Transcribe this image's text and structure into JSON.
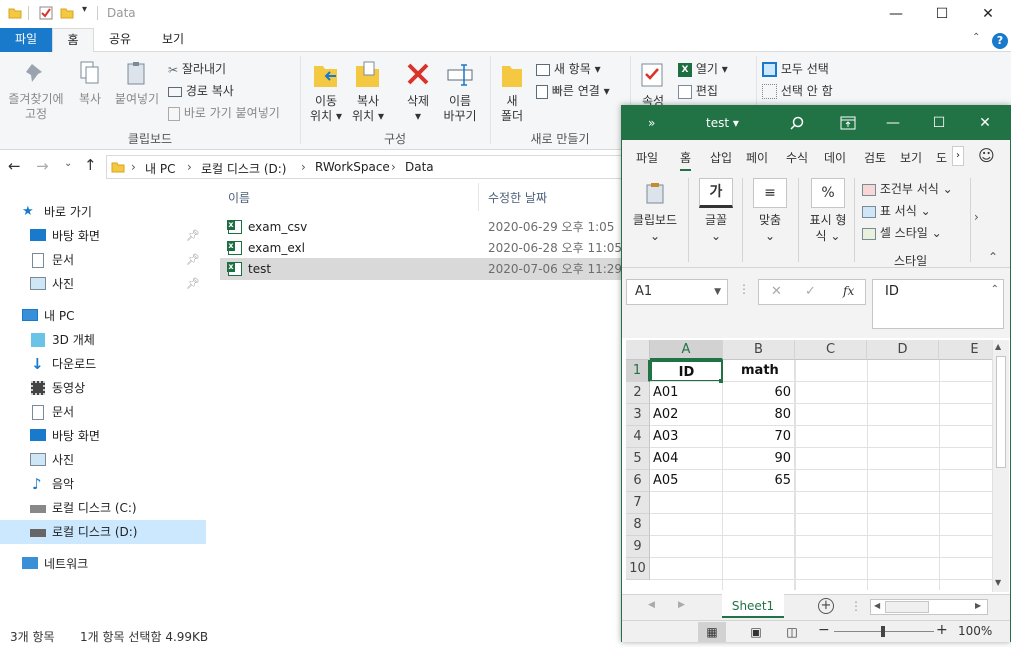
{
  "explorer": {
    "window_title": "Data",
    "tabs": {
      "file": "파일",
      "home": "홈",
      "share": "공유",
      "view": "보기"
    },
    "ribbon": {
      "pin_quick": [
        "즐겨찾기에",
        "고정"
      ],
      "copy": "복사",
      "paste": "붙여넣기",
      "cut": "잘라내기",
      "copy_path": "경로 복사",
      "paste_shortcut": "바로 가기 붙여넣기",
      "clipboard_group": "클립보드",
      "move_to": [
        "이동",
        "위치"
      ],
      "copy_to": [
        "복사",
        "위치"
      ],
      "delete": "삭제",
      "rename": [
        "이름",
        "바꾸기"
      ],
      "organize_group": "구성",
      "new_folder": [
        "새",
        "폴더"
      ],
      "new_item": "새 항목",
      "easy_access": "빠른 연결",
      "new_group": "새로 만들기",
      "properties": "속성",
      "open": "열기",
      "edit": "편집",
      "select_all": "모두 선택",
      "select_none": "선택 안 함"
    },
    "breadcrumb": [
      "내 PC",
      "로컬 디스크 (D:)",
      "RWorkSpace",
      "Data"
    ],
    "nav": {
      "quick_access": "바로 가기",
      "desktop": "바탕 화면",
      "documents": "문서",
      "pictures": "사진",
      "this_pc": "내 PC",
      "objects3d": "3D 개체",
      "downloads": "다운로드",
      "videos": "동영상",
      "documents2": "문서",
      "desktop2": "바탕 화면",
      "pictures2": "사진",
      "music": "음악",
      "disk_c": "로컬 디스크 (C:)",
      "disk_d": "로컬 디스크 (D:)",
      "network": "네트워크"
    },
    "columns": {
      "name": "이름",
      "modified": "수정한 날짜"
    },
    "files": [
      {
        "name": "exam_csv",
        "date": "2020-06-29 오후 1:05"
      },
      {
        "name": "exam_exl",
        "date": "2020-06-28 오후 11:05"
      },
      {
        "name": "test",
        "date": "2020-07-06 오후 11:29"
      }
    ],
    "status": {
      "count": "3개 항목",
      "selected": "1개 항목 선택함 4.99KB"
    }
  },
  "excel": {
    "title": "test",
    "tabs": [
      "파일",
      "홈",
      "삽입",
      "페이",
      "수식",
      "데이",
      "검토",
      "보기",
      "도"
    ],
    "ribbon": {
      "clipboard": "클립보드",
      "font": "글꼴",
      "font_icon": "가",
      "align": "맞춤",
      "number": [
        "표시 형",
        "식"
      ],
      "number_icon": "%",
      "cond_format": "조건부 서식",
      "table_format": "표 서식",
      "cell_style": "셀 스타일",
      "styles_group": "스타일"
    },
    "name_box": "A1",
    "formula_value": "ID",
    "fx": "fx",
    "columns": [
      "A",
      "B",
      "C",
      "D",
      "E"
    ],
    "rows": [
      "1",
      "2",
      "3",
      "4",
      "5",
      "6",
      "7",
      "8",
      "9",
      "10"
    ],
    "cells": [
      [
        "ID",
        "math"
      ],
      [
        "A01",
        "60"
      ],
      [
        "A02",
        "80"
      ],
      [
        "A03",
        "70"
      ],
      [
        "A04",
        "90"
      ],
      [
        "A05",
        "65"
      ]
    ],
    "sheet_tab": "Sheet1",
    "zoom": "100%"
  }
}
